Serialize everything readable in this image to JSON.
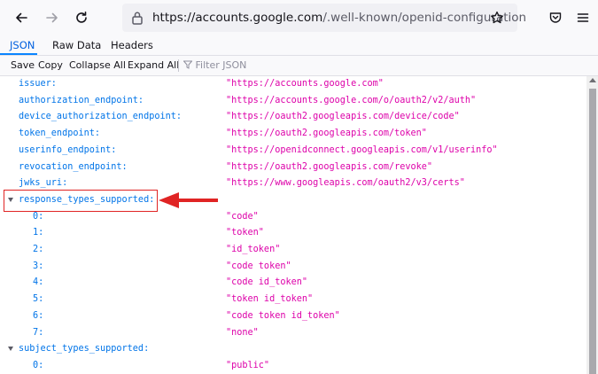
{
  "browser": {
    "url_domain": "https://accounts.google.com",
    "url_path": "/.well-known/openid-configuration"
  },
  "tabs": [
    "JSON",
    "Raw Data",
    "Headers"
  ],
  "toolbar": {
    "save": "Save",
    "copy": "Copy",
    "collapse_all": "Collapse All",
    "expand_all": "Expand All",
    "filter_placeholder": "Filter JSON"
  },
  "json_rows": [
    {
      "key": "issuer:",
      "value": "\"https://accounts.google.com\""
    },
    {
      "key": "authorization_endpoint:",
      "value": "\"https://accounts.google.com/o/oauth2/v2/auth\""
    },
    {
      "key": "device_authorization_endpoint:",
      "value": "\"https://oauth2.googleapis.com/device/code\""
    },
    {
      "key": "token_endpoint:",
      "value": "\"https://oauth2.googleapis.com/token\""
    },
    {
      "key": "userinfo_endpoint:",
      "value": "\"https://openidconnect.googleapis.com/v1/userinfo\""
    },
    {
      "key": "revocation_endpoint:",
      "value": "\"https://oauth2.googleapis.com/revoke\""
    },
    {
      "key": "jwks_uri:",
      "value": "\"https://www.googleapis.com/oauth2/v3/certs\""
    },
    {
      "key": "response_types_supported:",
      "value": ""
    },
    {
      "key": "0:",
      "value": "\"code\""
    },
    {
      "key": "1:",
      "value": "\"token\""
    },
    {
      "key": "2:",
      "value": "\"id_token\""
    },
    {
      "key": "3:",
      "value": "\"code token\""
    },
    {
      "key": "4:",
      "value": "\"code id_token\""
    },
    {
      "key": "5:",
      "value": "\"token id_token\""
    },
    {
      "key": "6:",
      "value": "\"code token id_token\""
    },
    {
      "key": "7:",
      "value": "\"none\""
    },
    {
      "key": "subject_types_supported:",
      "value": ""
    },
    {
      "key": "0:",
      "value": "\"public\""
    }
  ],
  "colors": {
    "key": "#0074e8",
    "string_value": "#dd00a9",
    "annotation": "#e02424"
  }
}
